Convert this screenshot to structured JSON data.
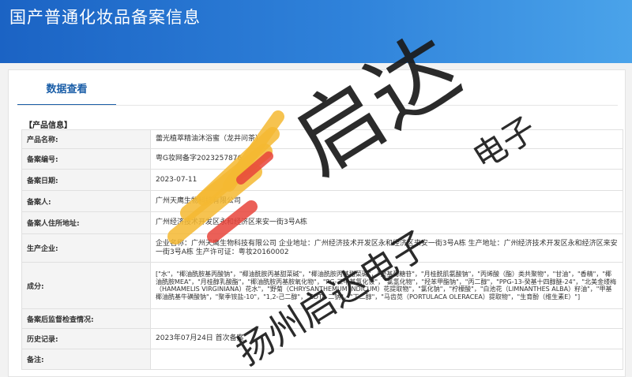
{
  "header": {
    "title": "国产普通化妆品备案信息"
  },
  "tabs": [
    {
      "label": "数据查看"
    }
  ],
  "section_title": "【产品信息】",
  "rows": [
    {
      "label": "产品名称:",
      "value": "蕾光植萃精油沐浴蜜（龙井问茶）"
    },
    {
      "label": "备案编号:",
      "value": "粤G妆网备字2023257876"
    },
    {
      "label": "备案日期:",
      "value": "2023-07-11"
    },
    {
      "label": "备案人:",
      "value": "广州天鹰生物科技有限公司"
    },
    {
      "label": "备案人住所地址:",
      "value": "广州经济技术开发区永和经济区来安一街3号A栋"
    },
    {
      "label": "生产企业:",
      "value": "企业名称：广州天鹰生物科技有限公司 企业地址：广州经济技术开发区永和经济区来安一街3号A栋 生产地址：广州经济技术开发区永和经济区来安一街3号A栋 生产许可证：粤妆20160002"
    },
    {
      "label": "成分:",
      "value": "[\"水\"，\"椰油酰胺基丙酸钠\"，\"椰油酰胺丙基甜菜碱\"，\"椰油酰胺丙基甜菜碱\"，\"癸基葡糖苷\"，\"月桂酰肌氨酸钠\"，\"丙烯酸（酯）类共聚物\"，\"甘油\"，\"香精\"，\"椰油酰胺MEA\"，\"月桂醇乳酸酯\"，\"椰油酰胺丙基胺氧化物\"，\"PG-三甲基氯化铵\"，\"氯氢化物\"，\"羟苯甲酯钠\"，\"丙二醇\"，\"PPG-13-癸基十四醇醚-24\"，\"北美金缕梅（HAMAMELIS VIRGINIANA）花水\"，\"野菊（CHRYSANTHEMUM INDICUM）花提取物\"，\"氯化钠\"，\"柠檬酸\"，\"白池花（LIMNANTHES ALBA）籽油\"，\"甲基椰油酰基牛磺酸钠\"，\"聚季铵盐-10\"，\"1,2-己二醇\"，\"EDTA 二钠\"，\"丁二醇\"，\"马齿苋（PORTULACA OLERACEA）提取物\"，\"生育酚（维生素E）\"]"
    },
    {
      "label": "备案后监督检查情况:",
      "value": ""
    },
    {
      "label": "历史记录:",
      "value": "2023年07月24日 首次备案"
    },
    {
      "label": "备注:",
      "value": ""
    }
  ],
  "watermark": {
    "text_big": "启达",
    "text_small": "扬州启达电子",
    "text_corner": "电子"
  },
  "colors": {
    "header_blue": "#1b63c4",
    "tab_blue": "#1c5fa8",
    "logo_yellow": "#f5b932",
    "logo_red": "#e8453c"
  }
}
